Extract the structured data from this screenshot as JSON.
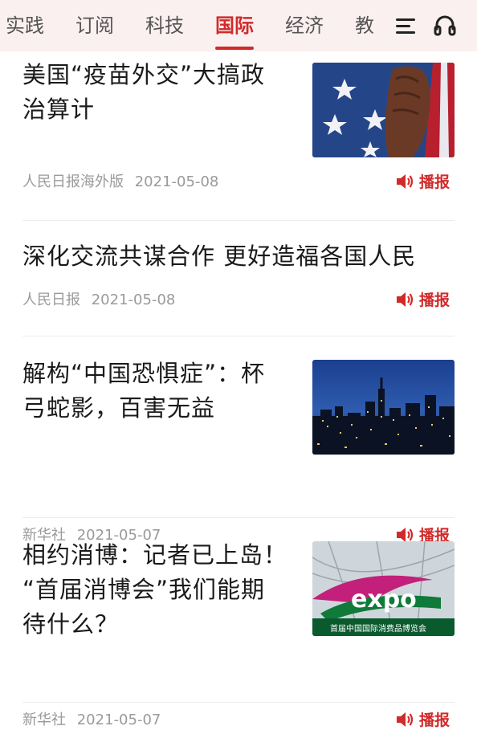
{
  "nav": {
    "tabs": [
      {
        "label": "实践"
      },
      {
        "label": "订阅"
      },
      {
        "label": "科技"
      },
      {
        "label": "国际"
      },
      {
        "label": "经济"
      },
      {
        "label": "教"
      }
    ],
    "active_tab": "国际",
    "menu_icon": "menu-icon",
    "headset_icon": "headphones-icon"
  },
  "articles": [
    {
      "title_lines": [
        "美国“疫苗外交”大搞政",
        "治算计"
      ],
      "source": "人民日报海外版",
      "date": "2021-05-08",
      "play_label": "播报",
      "thumbnail": "american-flag-fist"
    },
    {
      "title_lines": [
        "深化交流共谋合作  更好造福各国人民"
      ],
      "source": "人民日报",
      "date": "2021-05-08",
      "play_label": "播报",
      "thumbnail": null
    },
    {
      "title_lines": [
        "解构“中国恐惧症”：杯",
        "弓蛇影，百害无益"
      ],
      "source": "新华社",
      "date": "2021-05-07",
      "play_label": "播报",
      "thumbnail": "city-night-skyline"
    },
    {
      "title_lines": [
        "相约消博：记者已上岛！",
        "“首届消博会”我们能期",
        "待什么？"
      ],
      "source": "新华社",
      "date": "2021-05-07",
      "play_label": "播报",
      "thumbnail": "expo-sign",
      "thumbnail_text": {
        "logo": "expo",
        "caption": "首届中国国际消费品博览会"
      }
    }
  ],
  "colors": {
    "accent": "#d12a2a",
    "topbar_bg": "#fbf0f0",
    "meta_text": "#9a9a9a"
  }
}
